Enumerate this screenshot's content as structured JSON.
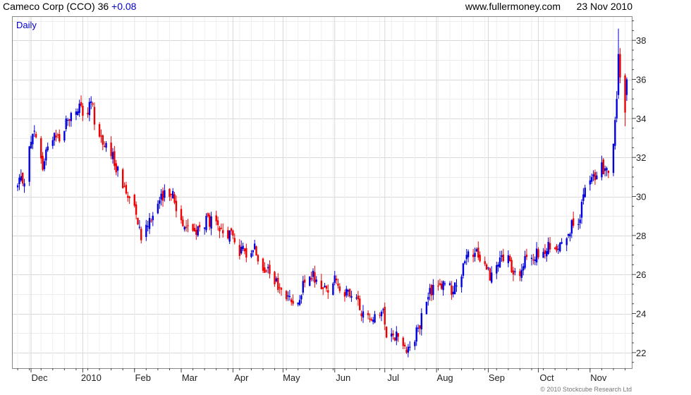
{
  "header": {
    "title": "Cameco Corp (CCO) 36",
    "change": "+0.08",
    "site": "www.fullermoney.com",
    "date": "23 Nov 2010"
  },
  "footer": {
    "copyright": "© 2010 Stockcube Research Ltd"
  },
  "colors": {
    "up": "#0000dd",
    "down": "#ee0000",
    "grid": "#d8d8d8",
    "frame": "#888888"
  },
  "chart_data": {
    "type": "candlestick",
    "period_label": "Daily",
    "ylim": [
      21.2,
      39.2
    ],
    "yticks": [
      22,
      24,
      26,
      28,
      30,
      32,
      34,
      36,
      38
    ],
    "xlabels": [
      "Dec",
      "2010",
      "Feb",
      "Mar",
      "Apr",
      "May",
      "Jun",
      "Jul",
      "Aug",
      "Sep",
      "Oct",
      "Nov"
    ],
    "grid": true,
    "close_path": [
      [
        "2009-11-23",
        30.5
      ],
      [
        "2009-11-27",
        31.0
      ],
      [
        "2009-12-01",
        32.8
      ],
      [
        "2009-12-03",
        33.2
      ],
      [
        "2009-12-08",
        31.5
      ],
      [
        "2009-12-11",
        32.5
      ],
      [
        "2009-12-15",
        33.4
      ],
      [
        "2009-12-18",
        32.9
      ],
      [
        "2009-12-22",
        33.8
      ],
      [
        "2009-12-28",
        34.5
      ],
      [
        "2010-01-04",
        34.2
      ],
      [
        "2010-01-06",
        34.9
      ],
      [
        "2010-01-08",
        34.0
      ],
      [
        "2010-01-12",
        33.0
      ],
      [
        "2010-01-15",
        32.5
      ],
      [
        "2010-01-20",
        31.8
      ],
      [
        "2010-01-26",
        30.3
      ],
      [
        "2010-02-01",
        29.8
      ],
      [
        "2010-02-05",
        28.0
      ],
      [
        "2010-02-10",
        28.9
      ],
      [
        "2010-02-15",
        29.6
      ],
      [
        "2010-02-19",
        30.0
      ],
      [
        "2010-02-23",
        30.4
      ],
      [
        "2010-02-26",
        29.3
      ],
      [
        "2010-03-03",
        28.6
      ],
      [
        "2010-03-08",
        28.2
      ],
      [
        "2010-03-12",
        28.3
      ],
      [
        "2010-03-17",
        28.8
      ],
      [
        "2010-03-22",
        28.4
      ],
      [
        "2010-03-26",
        28.0
      ],
      [
        "2010-03-31",
        28.1
      ],
      [
        "2010-04-05",
        27.2
      ],
      [
        "2010-04-09",
        27.1
      ],
      [
        "2010-04-13",
        27.5
      ],
      [
        "2010-04-16",
        27.0
      ],
      [
        "2010-04-21",
        26.2
      ],
      [
        "2010-04-26",
        25.6
      ],
      [
        "2010-04-29",
        25.2
      ],
      [
        "2010-05-03",
        24.8
      ],
      [
        "2010-05-07",
        24.6
      ],
      [
        "2010-05-11",
        25.0
      ],
      [
        "2010-05-14",
        25.5
      ],
      [
        "2010-05-19",
        25.9
      ],
      [
        "2010-05-24",
        25.4
      ],
      [
        "2010-05-27",
        25.2
      ],
      [
        "2010-06-01",
        25.8
      ],
      [
        "2010-06-04",
        25.4
      ],
      [
        "2010-06-09",
        24.9
      ],
      [
        "2010-06-14",
        24.6
      ],
      [
        "2010-06-17",
        24.1
      ],
      [
        "2010-06-22",
        23.6
      ],
      [
        "2010-06-25",
        24.2
      ],
      [
        "2010-06-30",
        23.9
      ],
      [
        "2010-07-02",
        23.1
      ],
      [
        "2010-07-08",
        22.9
      ],
      [
        "2010-07-13",
        22.4
      ],
      [
        "2010-07-16",
        22.2
      ],
      [
        "2010-07-21",
        23.2
      ],
      [
        "2010-07-27",
        24.9
      ],
      [
        "2010-08-02",
        25.6
      ],
      [
        "2010-08-06",
        25.4
      ],
      [
        "2010-08-11",
        25.2
      ],
      [
        "2010-08-16",
        26.1
      ],
      [
        "2010-08-20",
        26.9
      ],
      [
        "2010-08-26",
        27.1
      ],
      [
        "2010-08-31",
        26.3
      ],
      [
        "2010-09-03",
        25.9
      ],
      [
        "2010-09-08",
        26.6
      ],
      [
        "2010-09-13",
        26.9
      ],
      [
        "2010-09-16",
        25.8
      ],
      [
        "2010-09-21",
        26.2
      ],
      [
        "2010-09-24",
        26.8
      ],
      [
        "2010-09-29",
        27.0
      ],
      [
        "2010-10-04",
        26.9
      ],
      [
        "2010-10-07",
        27.4
      ],
      [
        "2010-10-12",
        27.2
      ],
      [
        "2010-10-15",
        27.9
      ],
      [
        "2010-10-20",
        28.4
      ],
      [
        "2010-10-25",
        28.6
      ],
      [
        "2010-10-28",
        30.0
      ],
      [
        "2010-11-01",
        30.8
      ],
      [
        "2010-11-04",
        31.0
      ],
      [
        "2010-11-08",
        31.4
      ],
      [
        "2010-11-10",
        31.5
      ],
      [
        "2010-11-12",
        31.4
      ],
      [
        "2010-11-15",
        32.4
      ],
      [
        "2010-11-16",
        33.9
      ],
      [
        "2010-11-17",
        35.0
      ],
      [
        "2010-11-18",
        36.7
      ],
      [
        "2010-11-19",
        37.2
      ],
      [
        "2010-11-22",
        36.6
      ],
      [
        "2010-11-23",
        36.0
      ]
    ],
    "recent_bars": [
      {
        "date": "2010-11-17",
        "open": 34.0,
        "high": 35.4,
        "low": 33.8,
        "close": 35.0
      },
      {
        "date": "2010-11-18",
        "open": 35.2,
        "high": 38.6,
        "low": 35.0,
        "close": 37.3
      },
      {
        "date": "2010-11-19",
        "open": 37.3,
        "high": 37.6,
        "low": 35.8,
        "close": 36.1
      },
      {
        "date": "2010-11-22",
        "open": 36.2,
        "high": 36.3,
        "low": 33.6,
        "close": 34.3
      },
      {
        "date": "2010-11-23",
        "open": 35.2,
        "high": 36.1,
        "low": 34.9,
        "close": 36.0
      }
    ]
  }
}
